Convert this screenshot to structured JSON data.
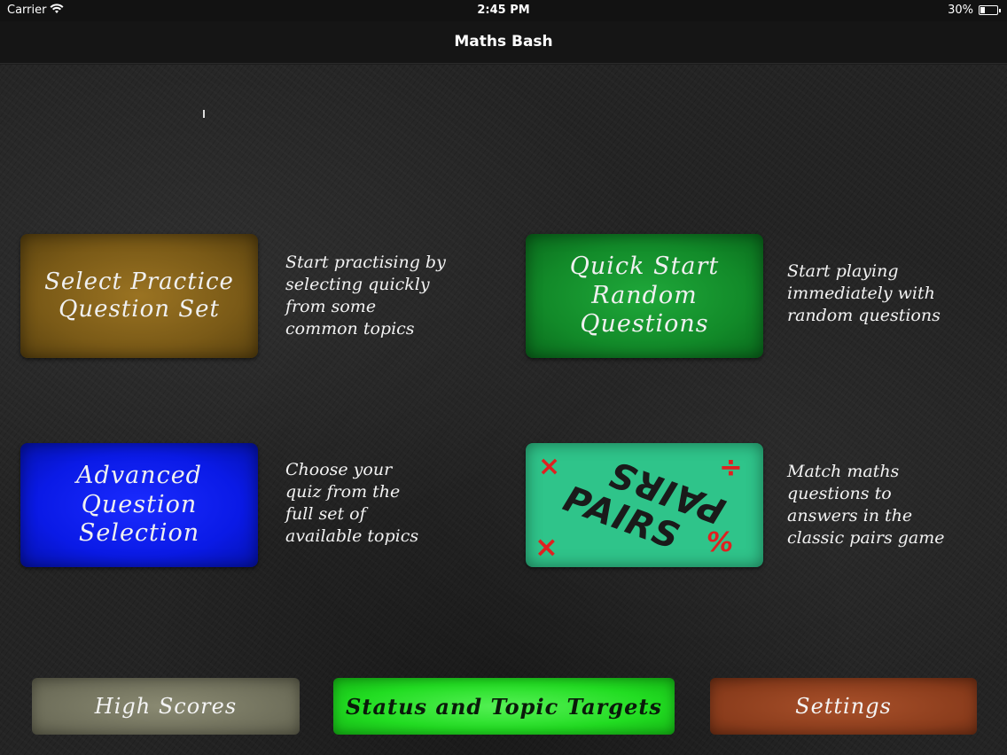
{
  "status_bar": {
    "carrier": "Carrier",
    "time": "2:45 PM",
    "battery_percent": "30%",
    "battery_level": 0.3
  },
  "nav": {
    "title": "Maths Bash"
  },
  "tiles": {
    "practice": {
      "label": "Select Practice\nQuestion Set",
      "description": "Start practising by\nselecting quickly\nfrom some\ncommon topics",
      "color": "#7a5a17"
    },
    "quick": {
      "label": "Quick Start\nRandom\nQuestions",
      "description": "Start playing\nimmediately with\nrandom questions",
      "color": "#128a29"
    },
    "advanced": {
      "label": "Advanced\nQuestion\nSelection",
      "description": "Choose your\nquiz from the\nfull set of\navailable topics",
      "color": "#0a1ae6"
    },
    "pairs": {
      "label": "PAIRS",
      "description": "Match maths\nquestions to\nanswers in the\nclassic pairs game",
      "color": "#2fc48a",
      "symbols": [
        "×",
        "÷",
        "×",
        "%"
      ]
    }
  },
  "bottom": {
    "high_scores": "High Scores",
    "status_targets": "Status and Topic Targets",
    "settings": "Settings"
  }
}
